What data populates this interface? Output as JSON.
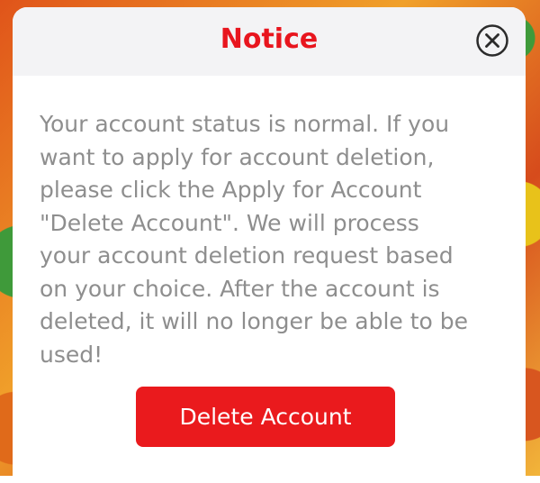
{
  "dialog": {
    "title": "Notice",
    "close_icon": "close-circle-icon",
    "message": "Your account status is normal. If you\nwant to apply for account deletion,\nplease click the Apply for Account\n\"Delete Account\". We will process\nyour account deletion request based\non your choice. After the account is\ndeleted, it will no longer be able to be\nused!",
    "delete_button_label": "Delete Account"
  },
  "colors": {
    "title": "#e8151e",
    "header_bg": "#f3f3f5",
    "message_text": "#8e8e8e",
    "button_bg": "#ea1a1d",
    "button_text": "#ffffff"
  }
}
